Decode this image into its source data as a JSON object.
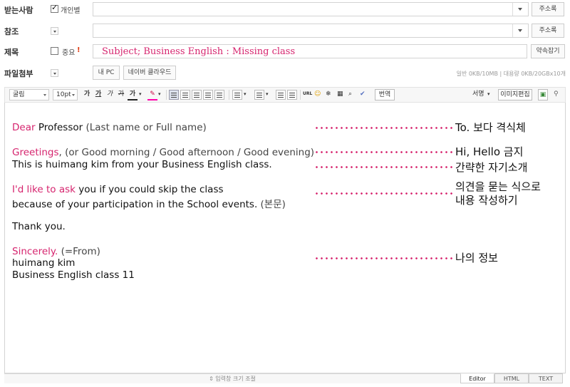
{
  "header": {
    "recipient_label": "받는사람",
    "individual_label": "개인별",
    "cc_label": "참조",
    "subject_label": "제목",
    "important_label": "중요",
    "important_mark": "!",
    "attach_label": "파일첨부",
    "address_book": "주소록",
    "subject_value": "Subject; Business English : Missing class",
    "shortcut_button": "약속잡기",
    "my_pc": "내 PC",
    "naver_cloud": "네이버 클라우드",
    "attach_info": "일반 0KB/10MB  |  대용량 0KB/20GBx10개"
  },
  "toolbar": {
    "font": "굴림",
    "size": "10pt",
    "bold": "가",
    "underline": "가",
    "italic": "가",
    "strike": "가",
    "color": "가",
    "translate": "번역",
    "signature": "서명",
    "image_edit": "이미지편집"
  },
  "body": {
    "l1_a": "Dear",
    "l1_b": " Professor",
    "l1_c": " (Last name or Full name)",
    "l2_a": "Greetings",
    "l2_b": ", (or Good morning / Good afternoon / Good evening)",
    "l3": "This is huimang kim from your Business English class.",
    "l4_a": "I'd like to ask",
    "l4_b": " you if you could skip the class",
    "l5_a": "because of your participation in the School events.",
    "l5_b": " (본문)",
    "l6": "Thank you.",
    "l7_a": "Sincerely.",
    "l7_b": " (=From)",
    "l8": "huimang kim",
    "l9": "Business English class 11"
  },
  "notes": {
    "n1": "To. 보다 격식체",
    "n2": "Hi, Hello 금지",
    "n3": "간략한 자기소개",
    "n4a": "의견을 묻는 식으로",
    "n4b": "내용 작성하기",
    "n5": "나의 정보"
  },
  "footer": {
    "resize": "⇕ 입력창 크기 조절",
    "tab_editor": "Editor",
    "tab_html": "HTML",
    "tab_text": "TEXT"
  },
  "colors": {
    "accent_pink": "#d6246e"
  }
}
